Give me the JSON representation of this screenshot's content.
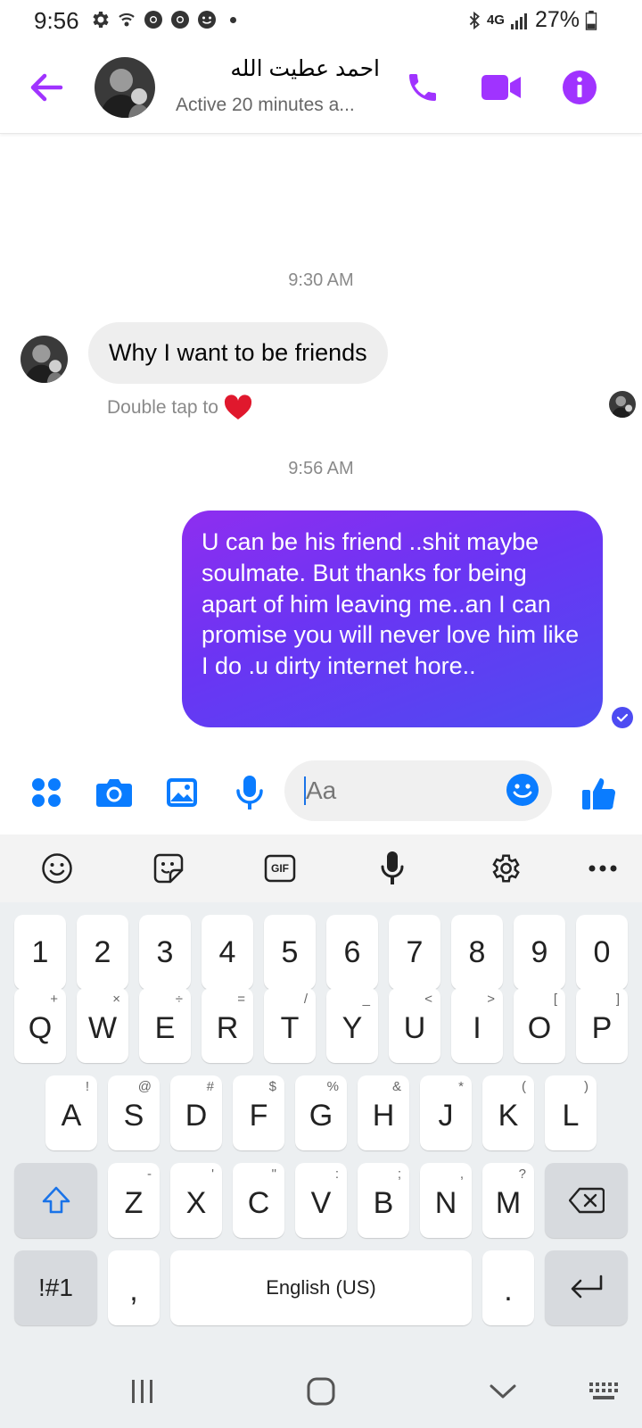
{
  "status_bar": {
    "time": "9:56",
    "network": "4G",
    "battery": "27%"
  },
  "header": {
    "contact_name": "احمد عطيت الله",
    "status": "Active 20 minutes a...",
    "icons": [
      "back-arrow-icon",
      "phone-icon",
      "video-camera-icon",
      "info-icon"
    ],
    "accent_color": "#a033ff"
  },
  "messages": {
    "timestamp_1": "9:30 AM",
    "incoming_text": "Why I want to be friends",
    "hint_text": "Double tap to",
    "timestamp_2": "9:56 AM",
    "outgoing_text": "U can be his friend ..shit maybe soulmate.  But thanks for being apart of him leaving me..an I can promise you will never love him like I do .u dirty internet hore.."
  },
  "composer": {
    "placeholder": "Aa",
    "icons": [
      "apps-icon",
      "camera-icon",
      "gallery-icon",
      "microphone-icon",
      "emoji-icon",
      "thumbs-up-icon"
    ],
    "icon_color": "#0a7cff"
  },
  "keyboard": {
    "toolbar_icons": [
      "emoji-icon",
      "sticker-icon",
      "gif-icon",
      "microphone-icon",
      "settings-icon",
      "more-icon"
    ],
    "gif_label": "GIF",
    "number_row": [
      "1",
      "2",
      "3",
      "4",
      "5",
      "6",
      "7",
      "8",
      "9",
      "0"
    ],
    "row1": [
      {
        "main": "Q",
        "sec": "+"
      },
      {
        "main": "W",
        "sec": "×"
      },
      {
        "main": "E",
        "sec": "÷"
      },
      {
        "main": "R",
        "sec": "="
      },
      {
        "main": "T",
        "sec": "/"
      },
      {
        "main": "Y",
        "sec": "_"
      },
      {
        "main": "U",
        "sec": "<"
      },
      {
        "main": "I",
        "sec": ">"
      },
      {
        "main": "O",
        "sec": "["
      },
      {
        "main": "P",
        "sec": "]"
      }
    ],
    "row2": [
      {
        "main": "A",
        "sec": "!"
      },
      {
        "main": "S",
        "sec": "@"
      },
      {
        "main": "D",
        "sec": "#"
      },
      {
        "main": "F",
        "sec": "$"
      },
      {
        "main": "G",
        "sec": "%"
      },
      {
        "main": "H",
        "sec": "&"
      },
      {
        "main": "J",
        "sec": "*"
      },
      {
        "main": "K",
        "sec": "("
      },
      {
        "main": "L",
        "sec": ")"
      }
    ],
    "row3": [
      {
        "main": "Z",
        "sec": "-"
      },
      {
        "main": "X",
        "sec": "'"
      },
      {
        "main": "C",
        "sec": "\""
      },
      {
        "main": "V",
        "sec": ":"
      },
      {
        "main": "B",
        "sec": ";"
      },
      {
        "main": "N",
        "sec": ","
      },
      {
        "main": "M",
        "sec": "?"
      }
    ],
    "symbols_label": "!#1",
    "comma_label": ",",
    "space_label": "English (US)",
    "period_label": "."
  },
  "nav_bar": {
    "icons": [
      "recent-apps-icon",
      "home-icon",
      "back-icon",
      "keyboard-icon"
    ]
  }
}
